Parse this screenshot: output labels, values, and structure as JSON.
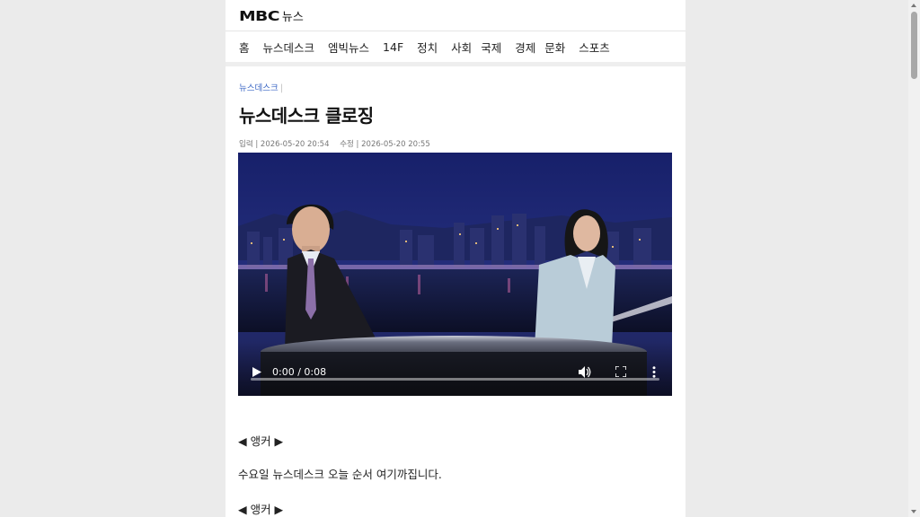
{
  "header": {
    "logo_mbc": "MBC",
    "logo_news": "뉴스"
  },
  "nav": {
    "items": [
      "홈",
      "뉴스데스크",
      "엠빅뉴스",
      "14F",
      "정치",
      "사회",
      "국제",
      "경제",
      "문화",
      "스포츠"
    ]
  },
  "article": {
    "category": "뉴스데스크",
    "category_sep": "|",
    "title": "뉴스데스크 클로징",
    "input_date": "입력 | 2026-05-20 20:54",
    "edit_date": "수정 | 2026-05-20 20:55"
  },
  "video": {
    "time": "0:00 / 0:08",
    "progress": 0,
    "icons": [
      "play-icon",
      "volume-icon",
      "fullscreen-icon",
      "more-vertical-icon"
    ]
  },
  "body": {
    "lines": [
      "◀ 앵커 ▶",
      "수요일 뉴스데스크 오늘 순서 여기까집니다.",
      "◀ 앵커 ▶"
    ]
  },
  "colors": {
    "category": "#3a66c4",
    "background": "#ebebeb",
    "video_sky": "#1a2166"
  }
}
